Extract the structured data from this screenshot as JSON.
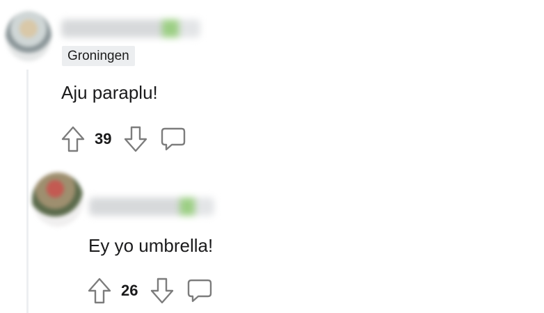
{
  "comments": [
    {
      "flair": "Groningen",
      "text": "Aju paraplu!",
      "score": "39",
      "icons": [
        "upvote-icon",
        "downvote-icon",
        "reply-icon"
      ]
    },
    {
      "text": "Ey yo umbrella!",
      "score": "26",
      "icons": [
        "upvote-icon",
        "downvote-icon",
        "reply-icon"
      ]
    }
  ],
  "colors": {
    "thread_line": "#edeff1",
    "flair_bg": "#eceef0",
    "icon_stroke": "#7c7c7c",
    "text": "#1a1a1b"
  }
}
